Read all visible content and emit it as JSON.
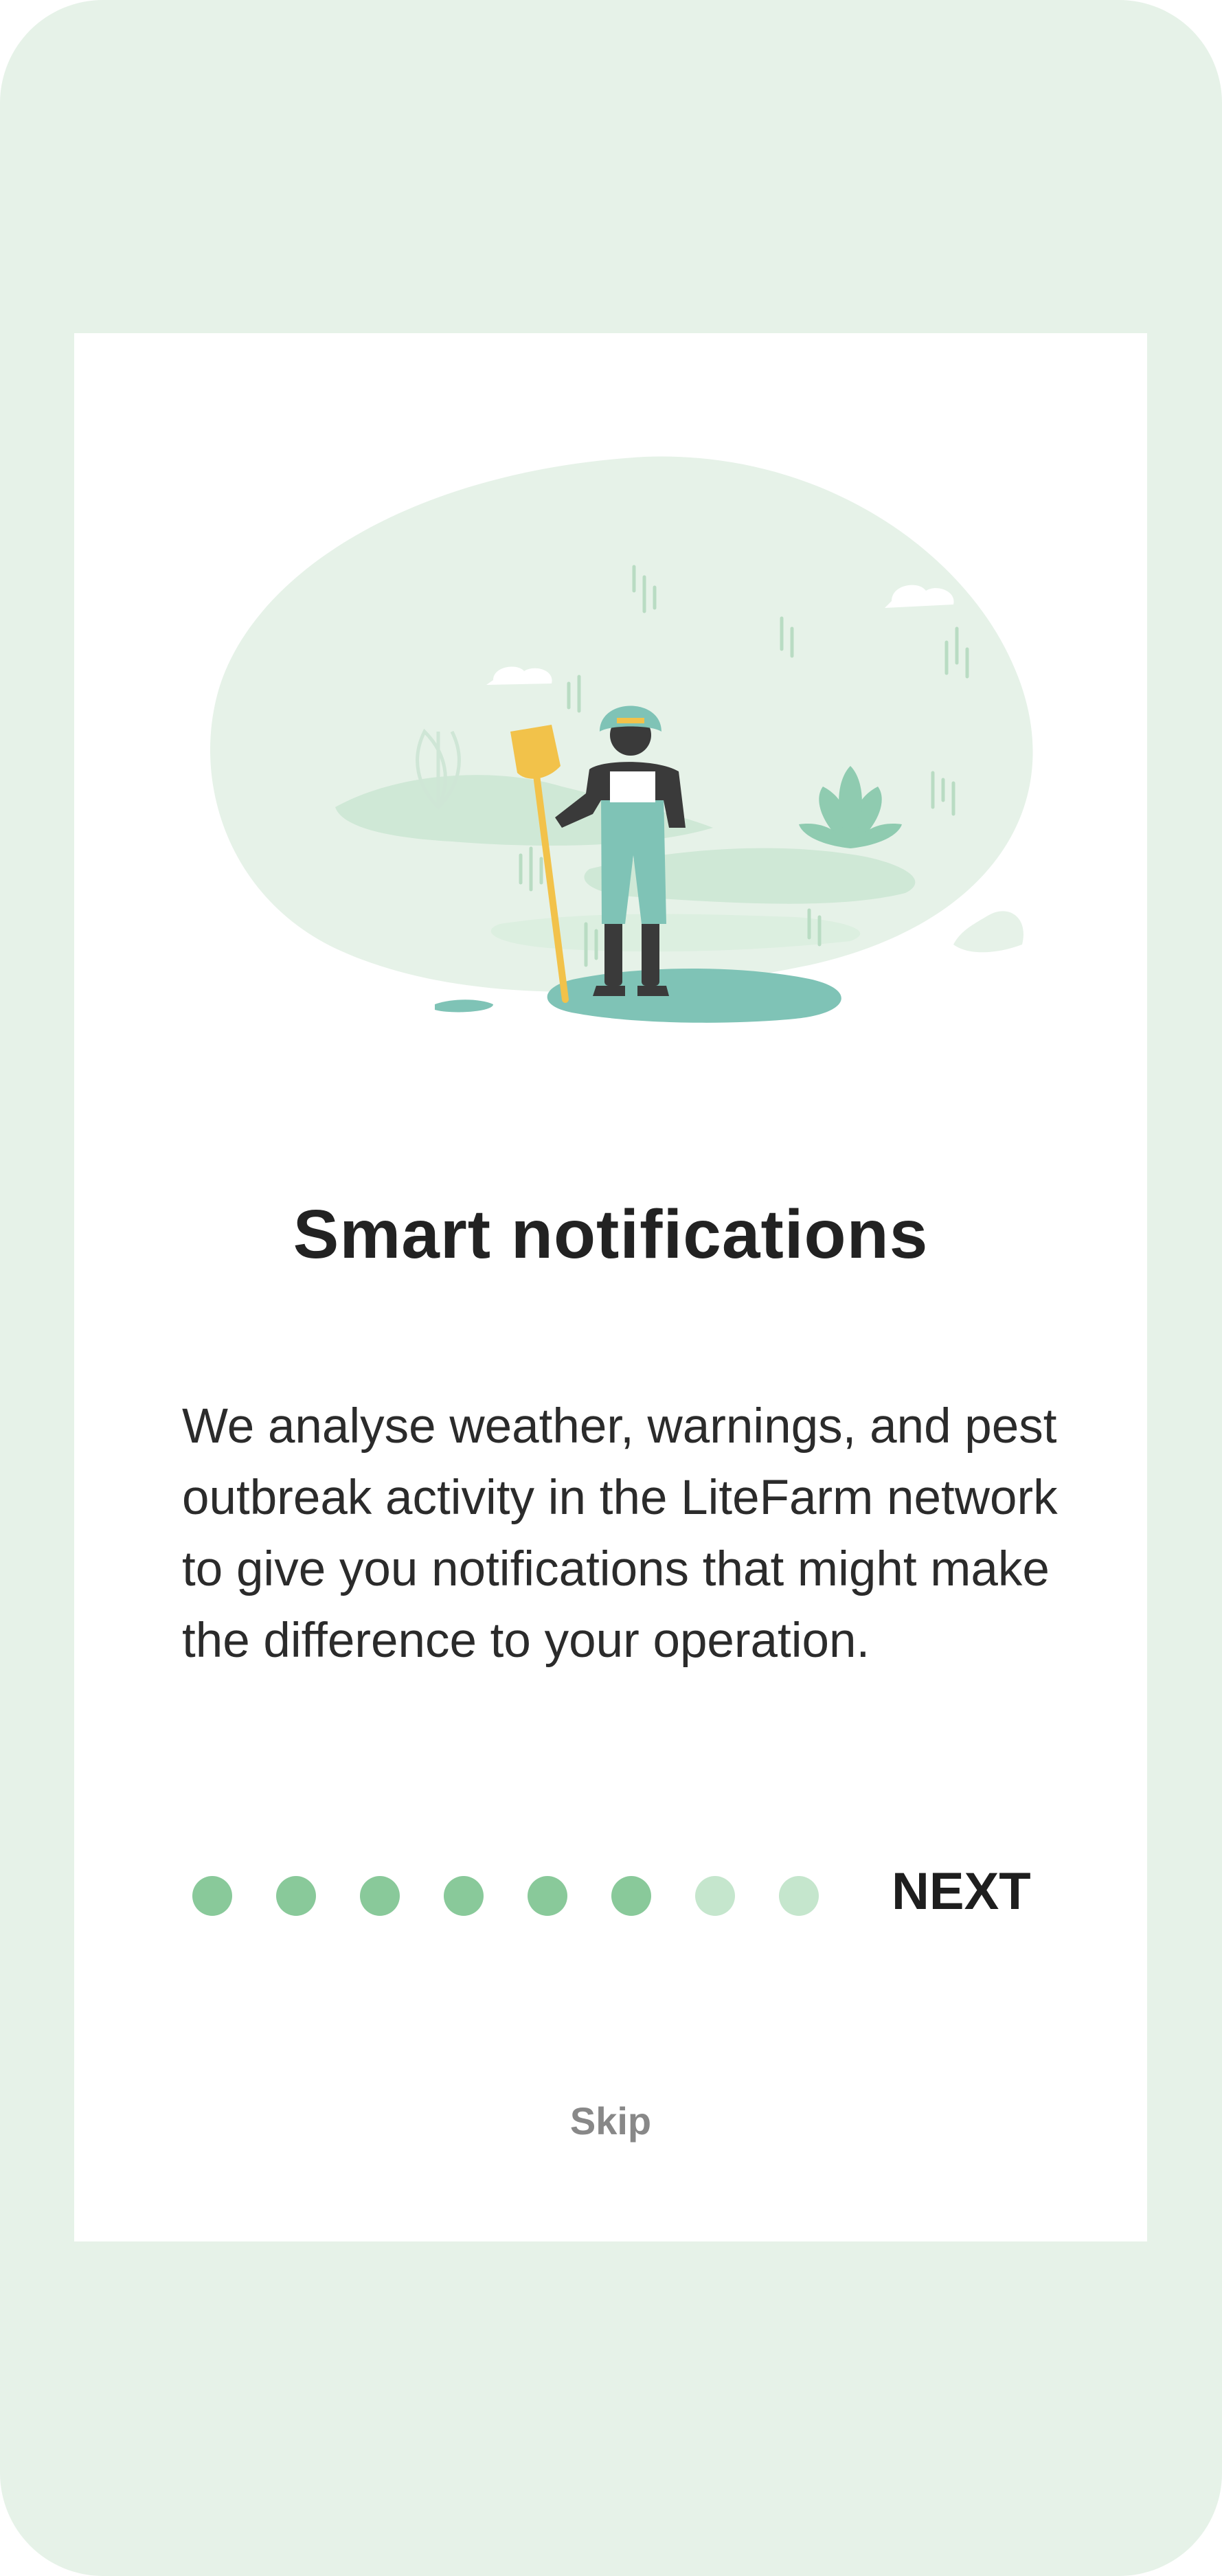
{
  "onboarding": {
    "title": "Smart notifications",
    "description": "We analyse weather, warnings, and pest outbreak activity in the LiteFarm network to give you notifications that might make the difference to your operation.",
    "next_label": "NEXT",
    "skip_label": "Skip",
    "illustration": "farmer-with-shovel-illustration"
  },
  "pagination": {
    "total_steps": 8,
    "active_steps": 6,
    "dots": [
      {
        "state": "active"
      },
      {
        "state": "active"
      },
      {
        "state": "active"
      },
      {
        "state": "active"
      },
      {
        "state": "active"
      },
      {
        "state": "active"
      },
      {
        "state": "inactive"
      },
      {
        "state": "inactive"
      }
    ]
  },
  "colors": {
    "background": "#e6f2e8",
    "card": "#ffffff",
    "dot_active": "#89c99a",
    "dot_inactive": "#c5e6cd",
    "title": "#222222",
    "skip": "#888888"
  }
}
